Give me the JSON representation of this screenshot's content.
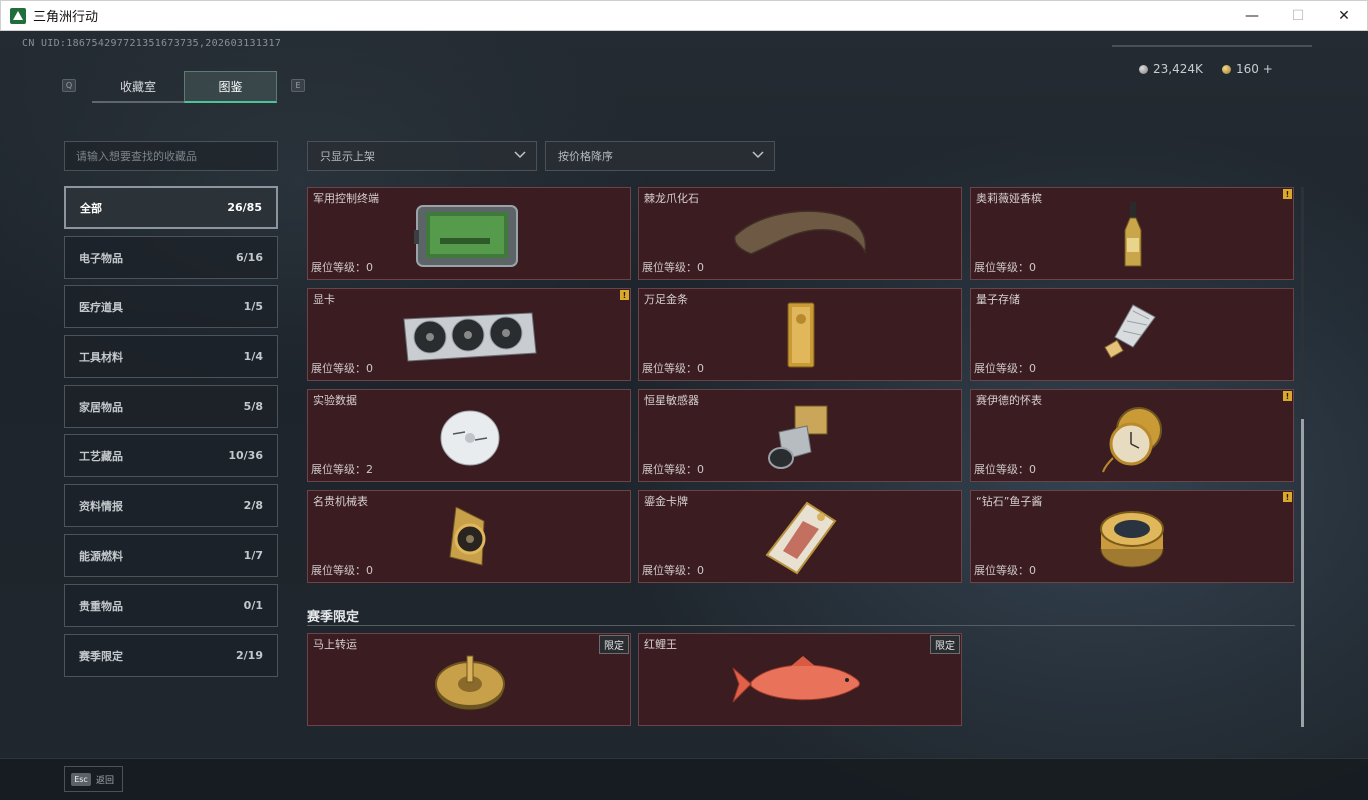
{
  "window": {
    "title": "三角洲行动",
    "minimize": "—",
    "maximize": "☐",
    "close": "✕"
  },
  "header": {
    "uid": "CN UID:18675429772135167373​5,202603131317",
    "key_left": "Q",
    "key_right": "E",
    "tabs": [
      {
        "label": "收藏室"
      },
      {
        "label": "图鉴"
      }
    ],
    "currency_silver": "23,424K",
    "currency_gold": "160 +"
  },
  "search": {
    "placeholder": "请输入想要查找的收藏品"
  },
  "filters": {
    "shelf": "只显示上架",
    "sort": "按价格降序"
  },
  "categories": [
    {
      "label": "全部",
      "count": "26/85"
    },
    {
      "label": "电子物品",
      "count": "6/16"
    },
    {
      "label": "医疗道具",
      "count": "1/5"
    },
    {
      "label": "工具材料",
      "count": "1/4"
    },
    {
      "label": "家居物品",
      "count": "5/8"
    },
    {
      "label": "工艺藏品",
      "count": "10/36"
    },
    {
      "label": "资料情报",
      "count": "2/8"
    },
    {
      "label": "能源燃料",
      "count": "1/7"
    },
    {
      "label": "贵重物品",
      "count": "0/1"
    },
    {
      "label": "赛季限定",
      "count": "2/19"
    }
  ],
  "items": [
    {
      "name": "军用控制终端",
      "level": "展位等级：0",
      "flag": "",
      "icon": "tablet-terminal-icon"
    },
    {
      "name": "棘龙爪化石",
      "level": "展位等级：0",
      "flag": "",
      "icon": "claw-fossil-icon"
    },
    {
      "name": "奥莉薇娅香槟",
      "level": "展位等级：0",
      "flag": "!",
      "icon": "champagne-bottle-icon"
    },
    {
      "name": "显卡",
      "level": "展位等级：0",
      "flag": "!",
      "icon": "graphics-card-icon"
    },
    {
      "name": "万足金条",
      "level": "展位等级：0",
      "flag": "",
      "icon": "gold-bar-icon"
    },
    {
      "name": "量子存储",
      "level": "展位等级：0",
      "flag": "",
      "icon": "quantum-storage-icon"
    },
    {
      "name": "实验数据",
      "level": "展位等级：2",
      "flag": "",
      "icon": "disc-icon"
    },
    {
      "name": "恒星敏感器",
      "level": "展位等级：0",
      "flag": "",
      "icon": "star-sensor-icon"
    },
    {
      "name": "赛伊德的怀表",
      "level": "展位等级：0",
      "flag": "!",
      "icon": "pocket-watch-icon"
    },
    {
      "name": "名贵机械表",
      "level": "展位等级：0",
      "flag": "",
      "icon": "wristwatch-icon"
    },
    {
      "name": "鎏金卡牌",
      "level": "展位等级：0",
      "flag": "",
      "icon": "gilded-card-icon"
    },
    {
      "name": "“钻石”鱼子酱",
      "level": "展位等级：0",
      "flag": "!",
      "icon": "caviar-tin-icon"
    }
  ],
  "season": {
    "title": "赛季限定",
    "items": [
      {
        "name": "马上转运",
        "badge": "限定",
        "icon": "fortune-wheel-icon"
      },
      {
        "name": "红鲤王",
        "badge": "限定",
        "icon": "red-carp-icon"
      }
    ]
  },
  "footer": {
    "esc_key": "Esc",
    "back_label": "返回"
  },
  "colors": {
    "accent": "#4ec39a",
    "card_bg": "#3b1c21",
    "flag": "#d9a92e"
  }
}
